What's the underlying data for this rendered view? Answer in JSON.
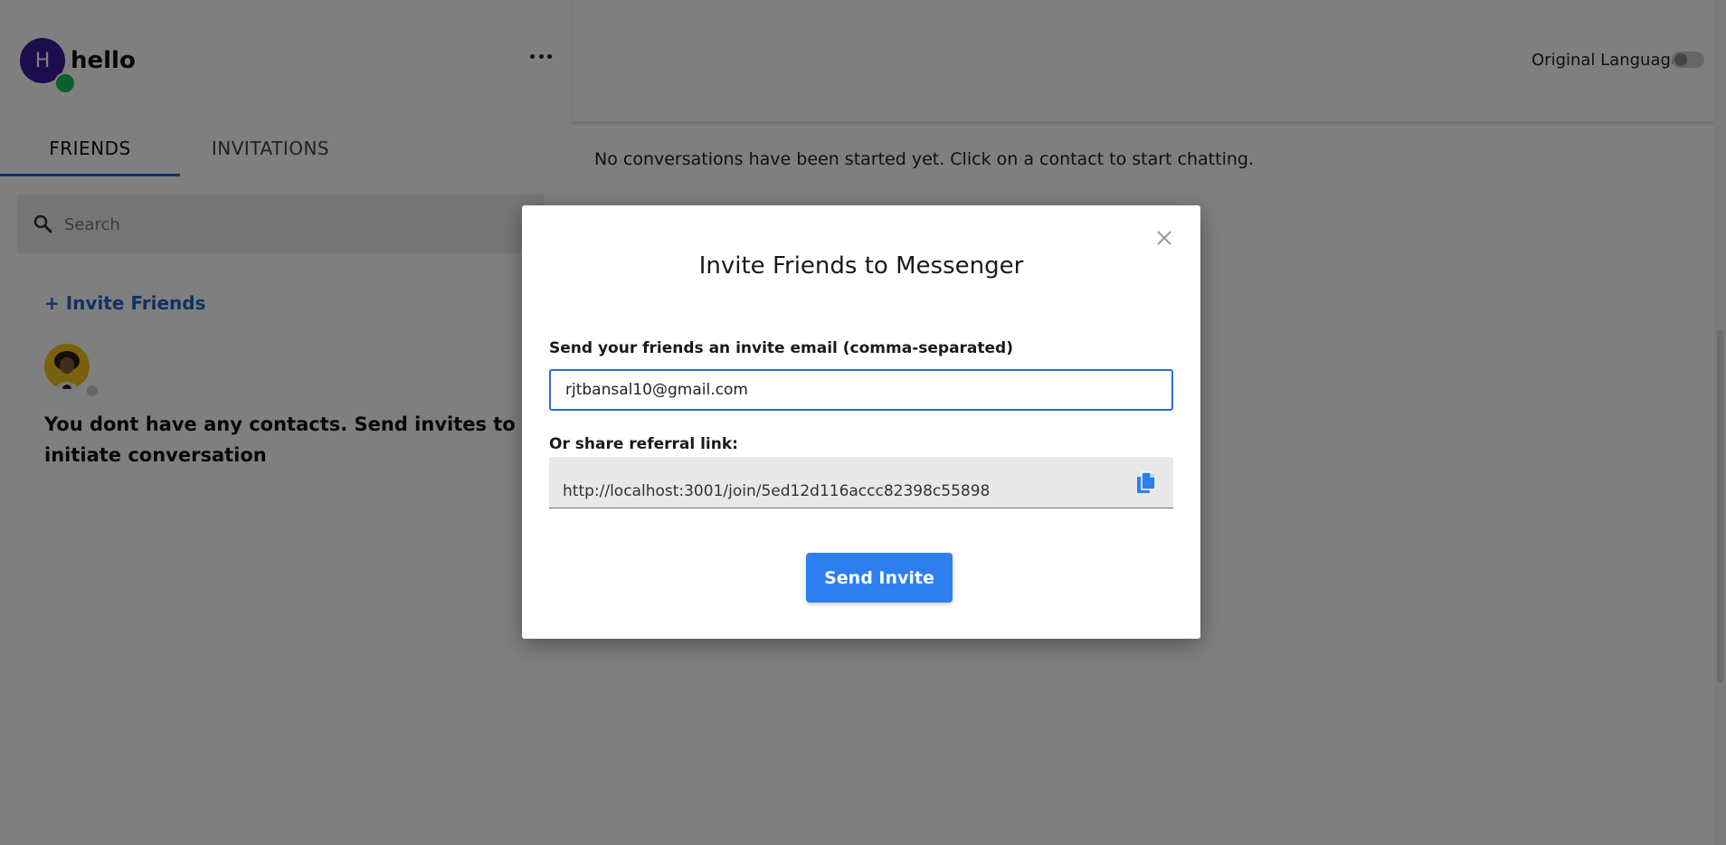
{
  "user": {
    "initial": "H",
    "name": "hello"
  },
  "tabs": [
    {
      "label": "FRIENDS",
      "active": true
    },
    {
      "label": "INVITATIONS",
      "active": false
    }
  ],
  "search": {
    "placeholder": "Search",
    "value": ""
  },
  "sidebar": {
    "invite_link": "+ Invite Friends",
    "empty_message": "You dont have any contacts. Send invites to initiate conversation"
  },
  "header": {
    "original_language_label": "Original Language",
    "original_language_enabled": false
  },
  "main": {
    "no_conversations": "No conversations have been started yet. Click on a contact to start chatting."
  },
  "modal": {
    "title": "Invite Friends to Messenger",
    "email_label": "Send your friends an invite email (comma-separated)",
    "email_value": "rjtbansal10@gmail.com",
    "referral_label": "Or share referral link:",
    "referral_link": "http://localhost:3001/join/5ed12d116accc82398c55898",
    "send_label": "Send Invite"
  },
  "colors": {
    "accent": "#2d7ff0",
    "link": "#1e64c8",
    "avatar_bg": "#3a1a9a",
    "online": "#19c160"
  },
  "icons": {
    "menu": "more-horizontal-icon",
    "search": "search-icon",
    "close": "close-icon",
    "copy": "copy-icon"
  }
}
